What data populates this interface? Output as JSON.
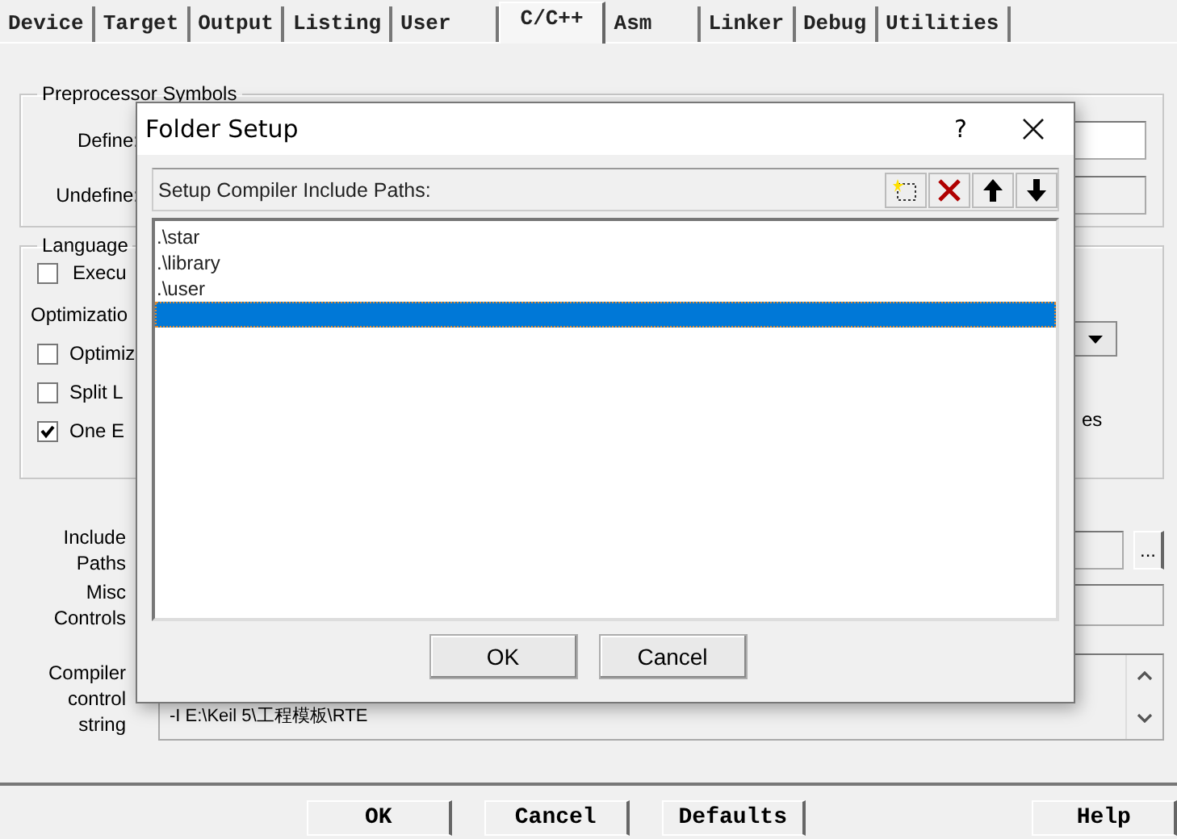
{
  "tabs": [
    {
      "label": "Device",
      "selected": false
    },
    {
      "label": "Target",
      "selected": false
    },
    {
      "label": "Output",
      "selected": false
    },
    {
      "label": "Listing",
      "selected": false
    },
    {
      "label": "User",
      "selected": false
    },
    {
      "label": "C/C++",
      "selected": true
    },
    {
      "label": "Asm",
      "selected": false
    },
    {
      "label": "Linker",
      "selected": false
    },
    {
      "label": "Debug",
      "selected": false
    },
    {
      "label": "Utilities",
      "selected": false
    }
  ],
  "preprocessor": {
    "title": "Preprocessor Symbols",
    "define_label": "Define:",
    "undefine_label": "Undefine:"
  },
  "language": {
    "title": "Language",
    "execute": {
      "label": "Execu",
      "checked": false
    },
    "optimization_label": "Optimizatio",
    "options": [
      {
        "label": "Optimiz",
        "checked": false
      },
      {
        "label": "Split L",
        "checked": false
      },
      {
        "label": "One E",
        "checked": true
      }
    ],
    "side_text": "es"
  },
  "include_paths": {
    "label": "Include Paths",
    "browse": "..."
  },
  "misc_controls": {
    "label": "Misc Controls"
  },
  "compiler_control": {
    "label": "Compiler control string",
    "value": "-I E:\\Keil 5\\工程模板\\RTE"
  },
  "buttons": [
    "OK",
    "Cancel",
    "Defaults",
    "Help"
  ],
  "dialog": {
    "title": "Folder Setup",
    "help": "?",
    "list_title": "Setup Compiler Include Paths:",
    "paths": [
      {
        "text": ".\\star",
        "selected": false
      },
      {
        "text": ".\\library",
        "selected": false
      },
      {
        "text": ".\\user",
        "selected": false
      }
    ],
    "edit_row_selected": true,
    "buttons": [
      "OK",
      "Cancel"
    ]
  }
}
